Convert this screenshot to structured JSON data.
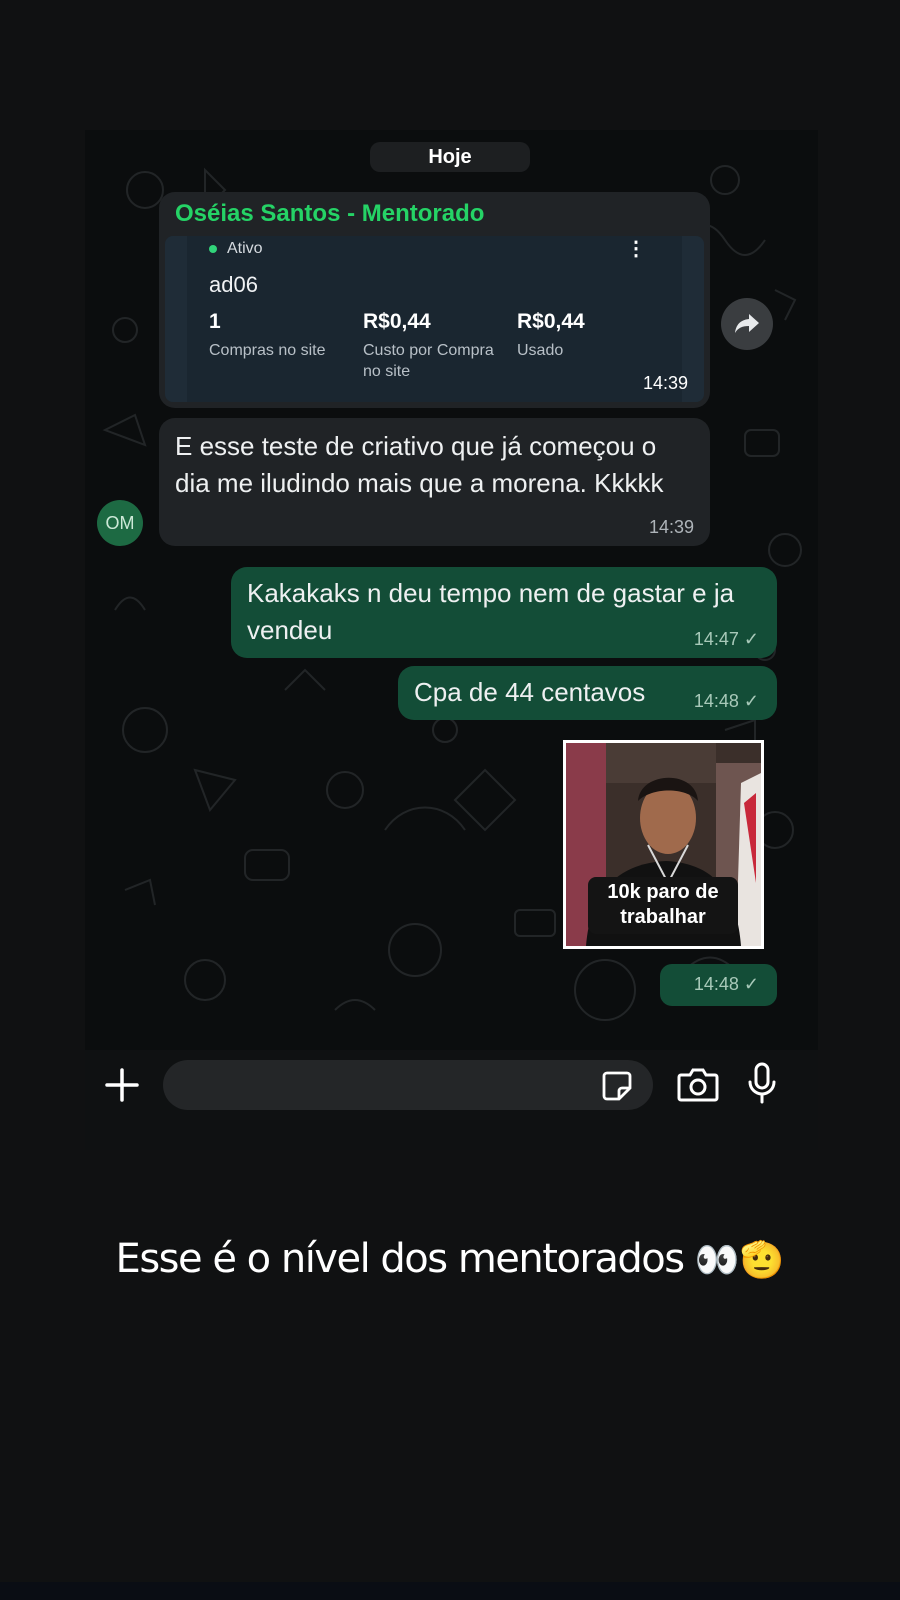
{
  "chat": {
    "date_label": "Hoje",
    "forwarded_card": {
      "sender": "Oséias Santos - Mentorado",
      "status": "Ativo",
      "ad_name": "ad06",
      "metrics": [
        {
          "value": "1",
          "label": "Compras no site"
        },
        {
          "value": "R$0,44",
          "label": "Custo por Compra no site"
        },
        {
          "value": "R$0,44",
          "label": "Usado"
        }
      ],
      "time": "14:39"
    },
    "messages": [
      {
        "direction": "incoming",
        "text": "E esse teste de criativo que já começou o dia me iludindo mais que a morena. Kkkkk",
        "time": "14:39"
      },
      {
        "direction": "outgoing",
        "text": "Kakakaks n deu tempo nem de gastar e ja vendeu",
        "time": "14:47"
      },
      {
        "direction": "outgoing",
        "text": "Cpa de 44 centavos",
        "time": "14:48"
      }
    ],
    "sticker": {
      "caption": "10k paro de trabalhar",
      "time": "14:48"
    },
    "avatar_initials": "OM",
    "colors": {
      "incoming": "#202326",
      "outgoing": "#134d37",
      "accent": "#25d366"
    }
  },
  "input_bar": {
    "icons": [
      "plus-icon",
      "sticker-icon",
      "camera-icon",
      "microphone-icon"
    ]
  },
  "story_caption": {
    "text": "Esse é o nível dos mentorados",
    "emoji": "👀🫡"
  }
}
